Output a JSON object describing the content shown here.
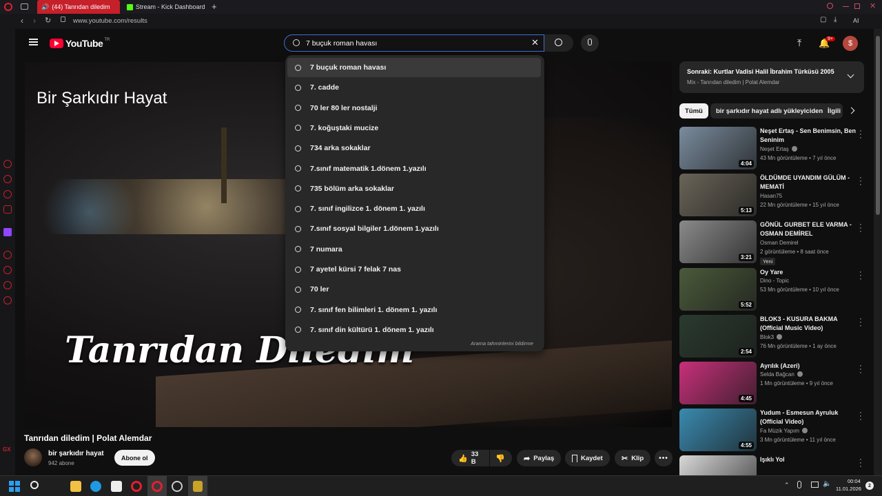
{
  "browser": {
    "tabs": [
      {
        "label": "(44) Tanrıdan diledim",
        "active": true
      },
      {
        "label": "Stream - Kick Dashboard",
        "active": false
      }
    ],
    "url": "www.youtube.com/results",
    "ai_label": "AI"
  },
  "header": {
    "logo_text": "YouTube",
    "logo_region": "TR",
    "notification_badge": "9+",
    "avatar_letter": "$"
  },
  "search": {
    "value": "7 buçuk roman havası",
    "suggestions": [
      "7 buçuk roman havası",
      "7. cadde",
      "70 ler 80 ler nostalji",
      "7. koğuştaki mucize",
      "734 arka sokaklar",
      "7.sınıf matematik 1.dönem 1.yazılı",
      "735 bölüm arka sokaklar",
      "7. sınıf ingilizce 1. dönem 1. yazılı",
      "7.sınıf sosyal bilgiler 1.dönem 1.yazılı",
      "7 numara",
      "7 ayetel kürsi 7 felak 7 nas",
      "70 ler",
      "7. sınıf fen bilimleri 1. dönem 1. yazılı",
      "7. sınıf din kültürü 1. dönem 1. yazılı"
    ],
    "report_label": "Arama tahminlerini bildirme"
  },
  "video": {
    "overlay_top": "Bir Şarkıdır Hayat",
    "overlay_bottom": "Tanrıdan Diledim",
    "title": "Tanrıdan diledim | Polat Alemdar",
    "channel": "bir şarkıdır hayat",
    "subscribers": "942 abone",
    "subscribe_label": "Abone ol",
    "likes": "33 B",
    "share_label": "Paylaş",
    "save_label": "Kaydet",
    "clip_label": "Klip"
  },
  "up_next": {
    "title": "Sonraki: Kurtlar Vadisi Halil İbrahim Türküsü 2005",
    "subtitle": "Mix - Tanrıdan diledim | Polat Alemdar"
  },
  "chips": [
    "Tümü",
    "bir şarkıdır hayat adlı yükleyiciden",
    "İlgili"
  ],
  "recommendations": [
    {
      "title": "Neşet Ertaş - Sen Benimsin, Ben Seninim",
      "channel": "Neşet Ertaş",
      "verified": true,
      "meta": "43 Mn görüntüleme • 7 yıl önce",
      "duration": "4:04",
      "badge": "",
      "thumb_color": "#7a8c9e"
    },
    {
      "title": "ÖLDÜMDE UYANDIM GÜLÜM - MEMATİ",
      "channel": "Hasan75",
      "verified": false,
      "meta": "22 Mn görüntüleme • 15 yıl önce",
      "duration": "5:13",
      "badge": "",
      "thumb_color": "#6a6458"
    },
    {
      "title": "GÖNÜL GURBET ELE VARMA - OSMAN DEMİREL",
      "channel": "Osman Demirel",
      "verified": false,
      "meta": "2 görüntüleme • 8 saat önce",
      "duration": "3:21",
      "badge": "Yeni",
      "thumb_color": "#8a8a8a"
    },
    {
      "title": "Oy Yare",
      "channel": "Dino - Topic",
      "verified": false,
      "meta": "53 Mn görüntüleme • 10 yıl önce",
      "duration": "5:52",
      "badge": "",
      "thumb_color": "#4a5a3a"
    },
    {
      "title": "BLOK3 - KUSURA BAKMA (Official Music Video)",
      "channel": "Blok3",
      "verified": true,
      "meta": "76 Mn görüntüleme • 1 ay önce",
      "duration": "2:54",
      "badge": "",
      "thumb_color": "#2a3a2e"
    },
    {
      "title": "Ayrılık (Azeri)",
      "channel": "Selda Bağcan",
      "verified": true,
      "meta": "1 Mn görüntüleme • 9 yıl önce",
      "duration": "4:45",
      "badge": "",
      "thumb_color": "#c8307a"
    },
    {
      "title": "Yudum - Esmesun Ayruluk (Official Video)",
      "channel": "Fa Müzik Yapım",
      "verified": true,
      "meta": "3 Mn görüntüleme • 11 yıl önce",
      "duration": "4:55",
      "badge": "",
      "thumb_color": "#3a8ab0"
    },
    {
      "title": "Işıklı Yol",
      "channel": "",
      "verified": false,
      "meta": "",
      "duration": "",
      "badge": "",
      "thumb_color": "#d8d8d8"
    }
  ],
  "taskbar": {
    "time": "00:04",
    "date": "11.01.2026",
    "notification_count": "2"
  }
}
